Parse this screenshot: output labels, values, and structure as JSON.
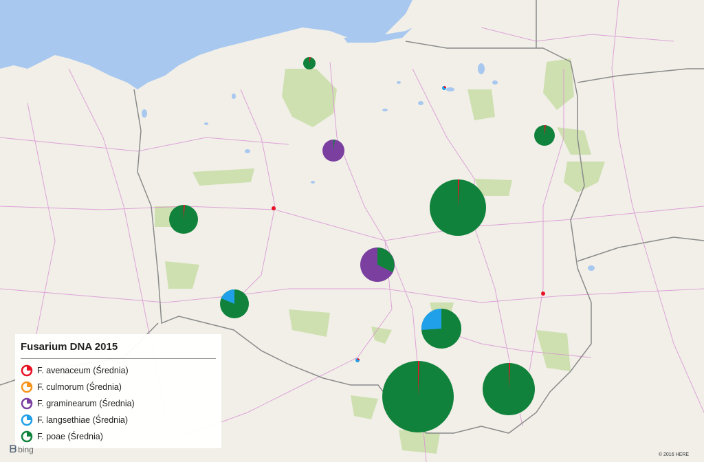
{
  "legend": {
    "title": "Fusarium DNA 2015",
    "items": [
      {
        "label": "F. avenaceum (Średnia)",
        "color": "#e81123",
        "icon": "pie-legend-icon"
      },
      {
        "label": "F. culmorum (Średnia)",
        "color": "#f7941d",
        "icon": "pie-legend-icon"
      },
      {
        "label": "F. graminearum (Średnia)",
        "color": "#7b3fa0",
        "icon": "pie-legend-icon"
      },
      {
        "label": "F. langsethiae (Średnia)",
        "color": "#1fa0e8",
        "icon": "pie-legend-icon"
      },
      {
        "label": "F. poae (Średnia)",
        "color": "#11823b",
        "icon": "pie-legend-icon"
      }
    ]
  },
  "map": {
    "provider": "bing",
    "copyright": "© 2016 HERE",
    "colors": {
      "water": "#a8c8f0",
      "land": "#f1efe8",
      "forest": "#cfe0b0",
      "border": "#8a8a8a",
      "road": "#d98fd4"
    }
  }
}
